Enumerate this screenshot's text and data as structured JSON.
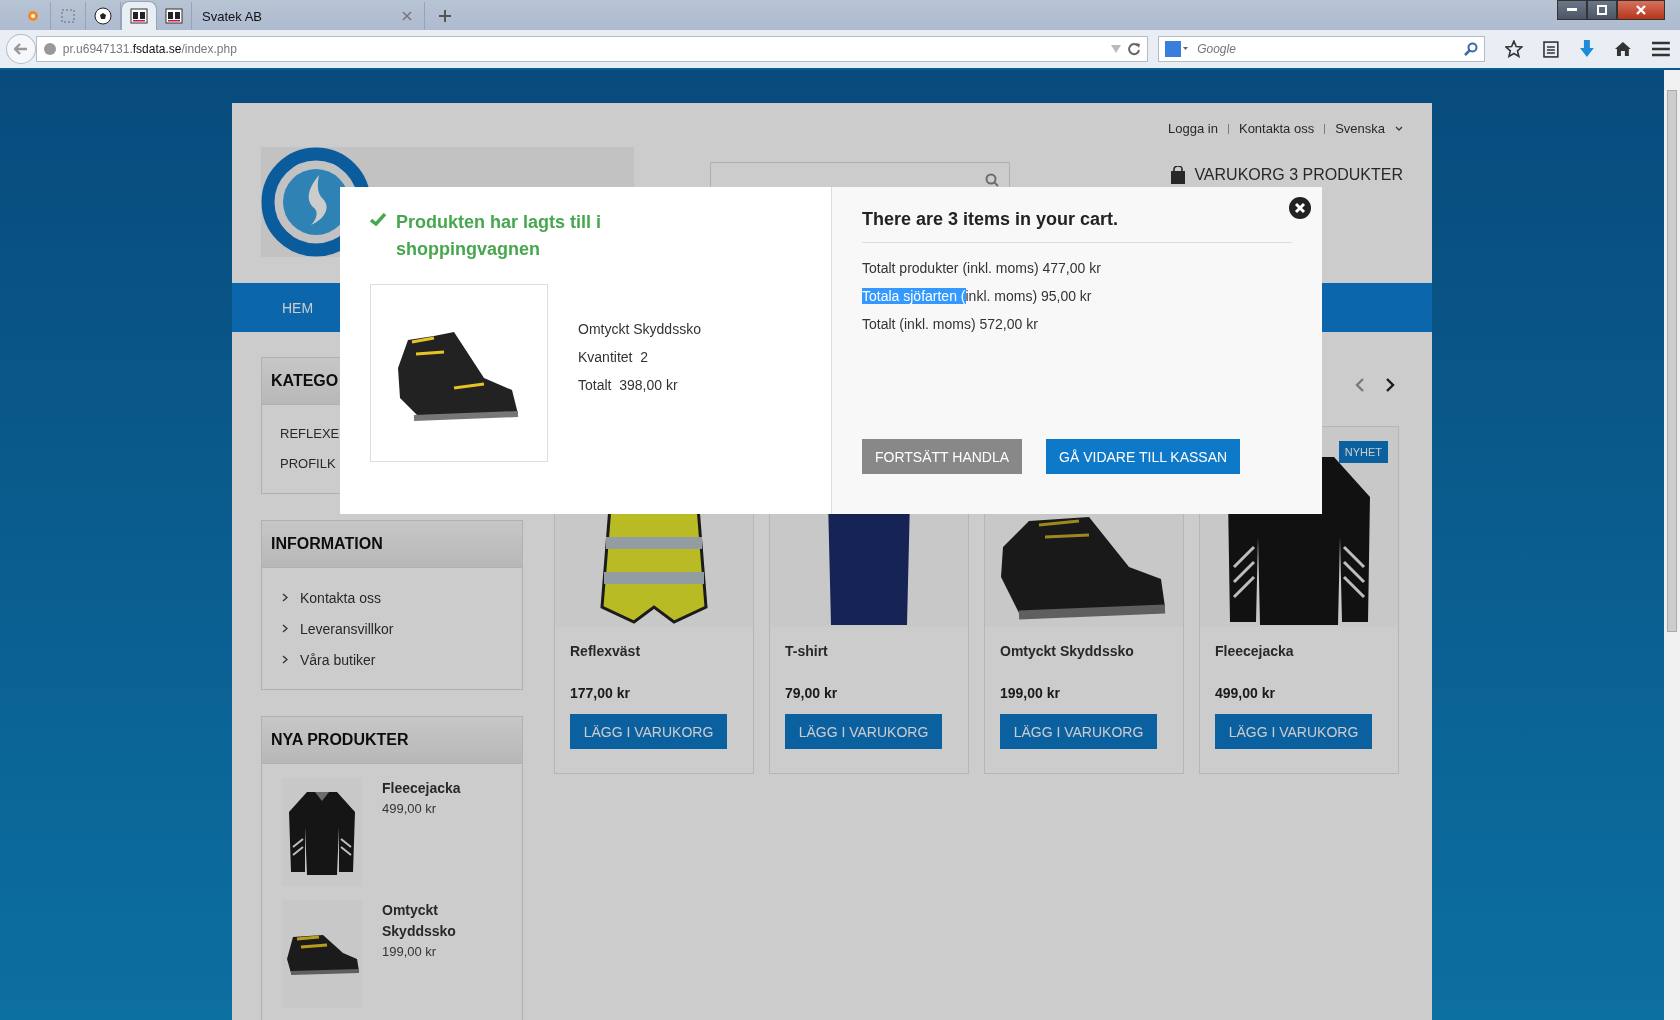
{
  "browser": {
    "tabs": [
      {
        "kind": "pinned",
        "selected": false
      },
      {
        "kind": "pinned",
        "selected": false
      },
      {
        "kind": "pinned",
        "selected": false
      },
      {
        "kind": "pinned",
        "selected": true
      },
      {
        "kind": "pinned",
        "selected": false
      },
      {
        "kind": "page",
        "title": "Svatek AB",
        "selected": false
      }
    ],
    "address": "pr.u6947131.**fsdata.se**/index.php",
    "search": {
      "placeholder": "Google"
    }
  },
  "header": {
    "top_links": [
      "Logga in",
      "Kontakta oss",
      "Svenska"
    ],
    "cart": "VARUKORG 3 PRODUKTER"
  },
  "nav": {
    "items": [
      "HEM"
    ]
  },
  "sidebar": {
    "categories": {
      "title": "KATEGO",
      "items": [
        "REFLEXE",
        "PROFILK"
      ]
    },
    "information": {
      "title": "INFORMATION",
      "items": [
        "Kontakta oss",
        "Leveransvillkor",
        "Våra butiker"
      ]
    },
    "new_products": {
      "title": "NYA PRODUKTER",
      "items": [
        {
          "name": "Fleecejacka",
          "price": "499,00 kr"
        },
        {
          "name": "Omtyckt Skyddssko",
          "price": "199,00 kr"
        }
      ]
    }
  },
  "products": [
    {
      "name": "Reflexväst",
      "price": "177,00 kr",
      "button": "LÄGG I VARUKORG"
    },
    {
      "name": "T-shirt",
      "price": "79,00 kr",
      "button": "LÄGG I VARUKORG"
    },
    {
      "name": "Omtyckt Skyddssko",
      "price": "199,00 kr",
      "button": "LÄGG I VARUKORG"
    },
    {
      "name": "Fleecejacka",
      "price": "499,00 kr",
      "button": "LÄGG I VARUKORG",
      "badge": "NYHET"
    }
  ],
  "modal": {
    "title": "Produkten har lagts till i shoppingvagnen",
    "product": {
      "name": "Omtyckt Skyddssko",
      "details": [
        {
          "label": "Kvantitet",
          "value": "2"
        },
        {
          "label": "Totalt",
          "value": "398,00 kr"
        }
      ]
    },
    "cart_title": "There are 3 items in your cart.",
    "lines": [
      {
        "text": "Totalt produkter (inkl. moms) 477,00 kr"
      },
      {
        "highlight": "Totala sjöfarten (",
        "text": "inkl. moms) 95,00 kr"
      },
      {
        "text": "Totalt (inkl. moms) 572,00 kr"
      }
    ],
    "buttons": [
      {
        "label": "FORTSÄTT HANDLA",
        "kind": "secondary"
      },
      {
        "label": "GÅ VIDARE TILL KASSAN",
        "kind": "primary"
      }
    ]
  }
}
